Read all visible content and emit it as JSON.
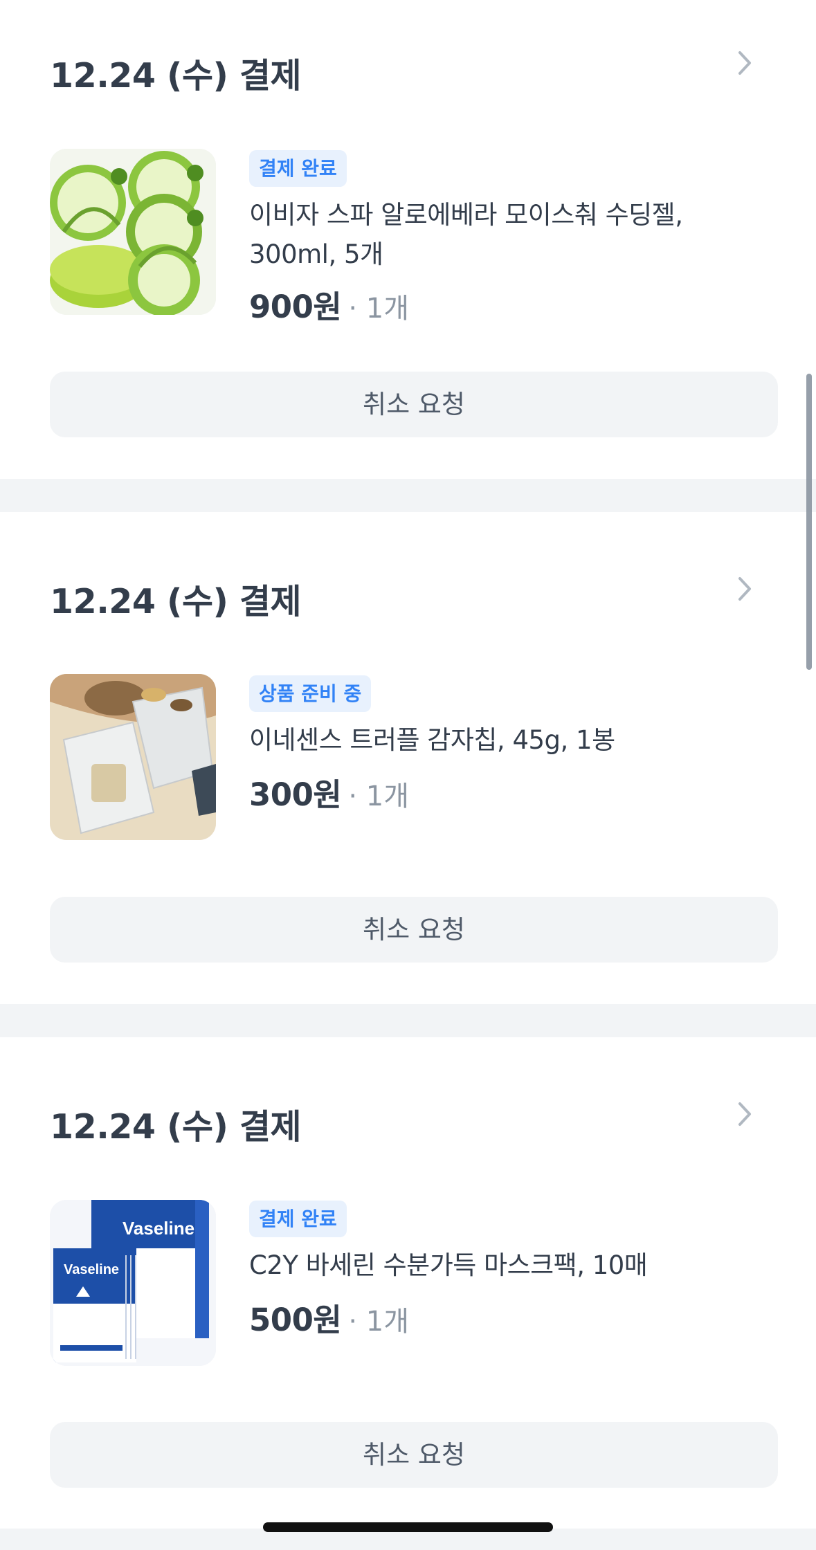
{
  "orders": [
    {
      "date_label": "12.24 (수) 결제",
      "status": "결제 완료",
      "product_name": "이비자 스파 알로에베라 모이스춰 수딩젤, 300ml, 5개",
      "price": "900원",
      "quantity": "· 1개",
      "cancel_label": "취소 요청",
      "image_icon": "aloe-vera-gel-product-image"
    },
    {
      "date_label": "12.24 (수) 결제",
      "status": "상품 준비 중",
      "product_name": "이네센스 트러플 감자칩, 45g, 1봉",
      "price": "300원",
      "quantity": "· 1개",
      "cancel_label": "취소 요청",
      "image_icon": "truffle-chips-product-image"
    },
    {
      "date_label": "12.24 (수) 결제",
      "status": "결제 완료",
      "product_name": "C2Y 바세린 수분가득 마스크팩, 10매",
      "price": "500원",
      "quantity": "· 1개",
      "cancel_label": "취소 요청",
      "image_icon": "vaseline-mask-product-image",
      "image_brand_text": "Vaseline"
    }
  ],
  "colors": {
    "badge_text": "#3182f6",
    "badge_bg": "#e8f1fd",
    "divider_bg": "#f2f4f6",
    "title_text": "#333d4b",
    "quantity_text": "#8b95a1"
  }
}
